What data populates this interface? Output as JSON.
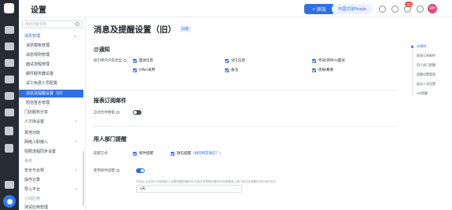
{
  "header": {
    "title": "设置",
    "add_label": "+ 添加",
    "brand_label": "中国式找People",
    "avatar_initials": "RH",
    "notification_count": "22"
  },
  "sidebar": {
    "search_placeholder": "搜索功能名称",
    "items": [
      {
        "label": "消息管理",
        "kind": "group"
      },
      {
        "label": "消息模板管理",
        "kind": "sub"
      },
      {
        "label": "消息规则管理",
        "kind": "sub"
      },
      {
        "label": "面试流程管理",
        "kind": "sub"
      },
      {
        "label": "邮件服务器设置",
        "kind": "sub"
      },
      {
        "label": "试工免费人员配置",
        "kind": "sub"
      },
      {
        "label": "消息及提醒设置（旧）",
        "kind": "sel"
      },
      {
        "label": "短信签名管理",
        "kind": "sub"
      },
      {
        "label": "门店服务分享",
        "kind": "item"
      },
      {
        "label": "人才库设置",
        "kind": "item"
      },
      {
        "label": "其他功能",
        "kind": "item"
      },
      {
        "label": "网络入职接入",
        "kind": "item"
      },
      {
        "label": "招聘流程同步设置",
        "kind": "item"
      },
      {
        "label": "系统",
        "kind": "muted"
      },
      {
        "label": "安全与合规",
        "kind": "item"
      },
      {
        "label": "操作记录",
        "kind": "item"
      },
      {
        "label": "导入平台",
        "kind": "item"
      },
      {
        "label": "订阅应用",
        "kind": "muted"
      },
      {
        "label": "测试应用管理",
        "kind": "item"
      }
    ]
  },
  "main": {
    "title": "消息及提醒设置（旧）",
    "tag": "旧版",
    "notify": {
      "heading": "@通知",
      "label": "展示模块内容类型",
      "options": [
        "面试信息",
        "试工信息",
        "考试/测评/AI面试",
        "Offer/录用",
        "备注",
        "周报/概要"
      ]
    },
    "report": {
      "heading": "报表订阅邮件",
      "label": "自动合并数据",
      "enabled": false
    },
    "reminder": {
      "heading": "用人部门提醒",
      "method_label": "提醒方式",
      "methods": [
        "邮件提醒",
        "微信提醒"
      ],
      "wechat_hint": "（如何绑定微信？）",
      "allow_label": "使用邮件提醒",
      "allow_enabled": true,
      "hint": "开启后,允许用户对被通知人设置提醒间隔时间,在面试前根据设置的时间提醒用人部门面试官提醒信息时间的时长",
      "select_value": "1天"
    }
  },
  "anchors": [
    "@通知",
    "报表订阅邮件",
    "用人部门提醒",
    "提醒设置管理",
    "面试人员设置",
    "HR提醒"
  ],
  "colors": {
    "accent": "#2f6fe4",
    "toggle_off": "#4b5160",
    "rail": "#262b35"
  }
}
